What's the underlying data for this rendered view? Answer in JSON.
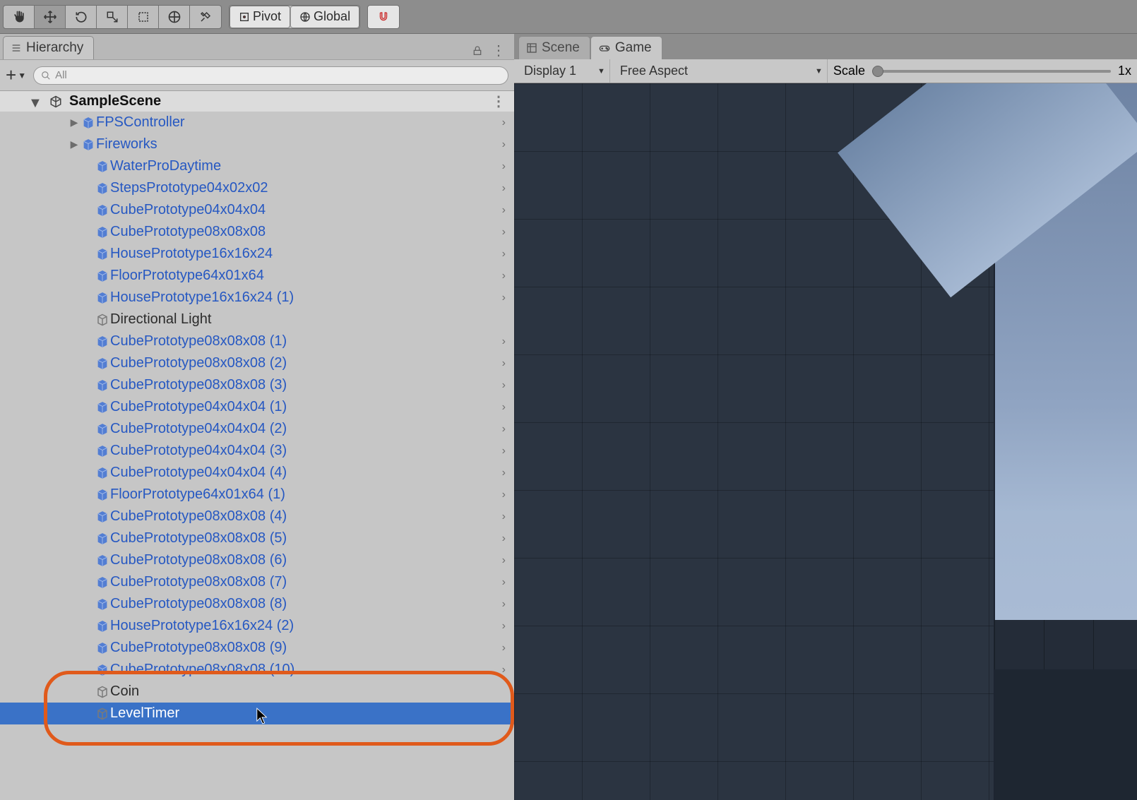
{
  "toolbar": {
    "pivot_label": "Pivot",
    "global_label": "Global"
  },
  "hierarchy": {
    "tab_label": "Hierarchy",
    "search_placeholder": "All",
    "scene_name": "SampleScene",
    "items": [
      {
        "label": "FPSController",
        "type": "prefab",
        "expandable": true,
        "chevron": true
      },
      {
        "label": "Fireworks",
        "type": "prefab",
        "expandable": true,
        "chevron": true
      },
      {
        "label": "WaterProDaytime",
        "type": "prefab",
        "chevron": true
      },
      {
        "label": "StepsPrototype04x02x02",
        "type": "prefab",
        "chevron": true
      },
      {
        "label": "CubePrototype04x04x04",
        "type": "prefab",
        "chevron": true
      },
      {
        "label": "CubePrototype08x08x08",
        "type": "prefab",
        "chevron": true
      },
      {
        "label": "HousePrototype16x16x24",
        "type": "prefab",
        "chevron": true
      },
      {
        "label": "FloorPrototype64x01x64",
        "type": "prefab",
        "chevron": true
      },
      {
        "label": "HousePrototype16x16x24 (1)",
        "type": "prefab",
        "chevron": true
      },
      {
        "label": "Directional Light",
        "type": "plain"
      },
      {
        "label": "CubePrototype08x08x08 (1)",
        "type": "prefab",
        "chevron": true
      },
      {
        "label": "CubePrototype08x08x08 (2)",
        "type": "prefab",
        "chevron": true
      },
      {
        "label": "CubePrototype08x08x08 (3)",
        "type": "prefab",
        "chevron": true
      },
      {
        "label": "CubePrototype04x04x04 (1)",
        "type": "prefab",
        "chevron": true
      },
      {
        "label": "CubePrototype04x04x04 (2)",
        "type": "prefab",
        "chevron": true
      },
      {
        "label": "CubePrototype04x04x04 (3)",
        "type": "prefab",
        "chevron": true
      },
      {
        "label": "CubePrototype04x04x04 (4)",
        "type": "prefab",
        "chevron": true
      },
      {
        "label": "FloorPrototype64x01x64 (1)",
        "type": "prefab",
        "chevron": true
      },
      {
        "label": "CubePrototype08x08x08 (4)",
        "type": "prefab",
        "chevron": true
      },
      {
        "label": "CubePrototype08x08x08 (5)",
        "type": "prefab",
        "chevron": true
      },
      {
        "label": "CubePrototype08x08x08 (6)",
        "type": "prefab",
        "chevron": true
      },
      {
        "label": "CubePrototype08x08x08 (7)",
        "type": "prefab",
        "chevron": true
      },
      {
        "label": "CubePrototype08x08x08 (8)",
        "type": "prefab",
        "chevron": true
      },
      {
        "label": "HousePrototype16x16x24 (2)",
        "type": "prefab",
        "chevron": true
      },
      {
        "label": "CubePrototype08x08x08 (9)",
        "type": "prefab",
        "chevron": true
      },
      {
        "label": "CubePrototype08x08x08 (10)",
        "type": "prefab",
        "chevron": true
      },
      {
        "label": "Coin",
        "type": "plain"
      },
      {
        "label": "LevelTimer",
        "type": "plain",
        "selected": true
      }
    ]
  },
  "viewport": {
    "scene_tab": "Scene",
    "game_tab": "Game",
    "display_label": "Display 1",
    "aspect_label": "Free Aspect",
    "scale_label": "Scale",
    "scale_value": "1x"
  }
}
